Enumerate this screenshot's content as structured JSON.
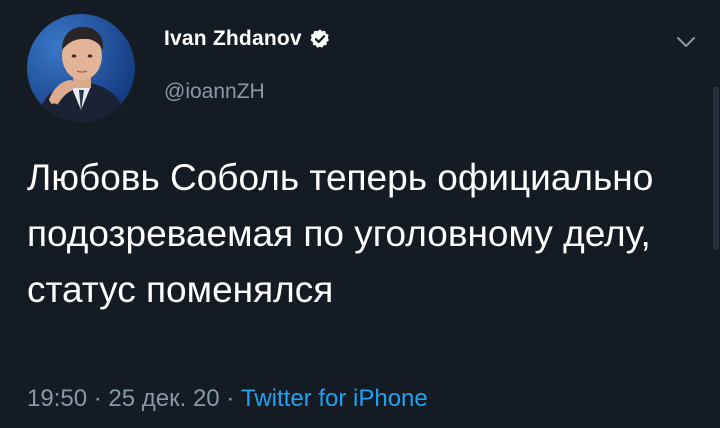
{
  "author": {
    "display_name": "Ivan Zhdanov",
    "handle": "@ioannZH",
    "verified": true,
    "avatar": "profile-photo"
  },
  "tweet": {
    "text": "Любовь Соболь теперь официально подозреваемая по уголовному делу, статус поменялся",
    "time": "19:50",
    "date": "25 дек. 20",
    "separator": "·",
    "source": "Twitter for iPhone"
  },
  "icons": {
    "menu": "chevron-down-icon",
    "verified": "verified-badge-icon"
  },
  "colors": {
    "background": "#151b23",
    "text": "#ffffff",
    "secondary": "#8899a6",
    "link": "#1da1f2"
  }
}
